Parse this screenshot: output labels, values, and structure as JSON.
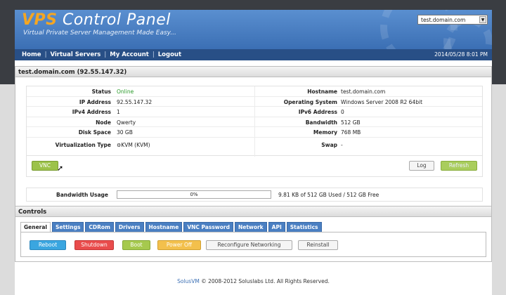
{
  "header": {
    "brand_accent": "VPS",
    "brand_rest": "Control Panel",
    "tagline": "Virtual Private Server Management Made Easy...",
    "server_select_value": "test.domain.com"
  },
  "nav": {
    "items": [
      "Home",
      "Virtual Servers",
      "My Account",
      "Logout"
    ],
    "separator": "|",
    "datetime": "2014/05/28 8:01 PM"
  },
  "server_panel": {
    "title": "test.domain.com (92.55.147.32)",
    "left": [
      {
        "label": "Status",
        "value": "Online"
      },
      {
        "label": "IP Address",
        "value": "92.55.147.32"
      },
      {
        "label": "IPv4 Address",
        "value": "1"
      },
      {
        "label": "Node",
        "value": "Qwerty"
      },
      {
        "label": "Disk Space",
        "value": "30 GB"
      },
      {
        "label": "Virtualization Type",
        "value": "KVM  (KVM)"
      }
    ],
    "right": [
      {
        "label": "Hostname",
        "value": "test.domain.com"
      },
      {
        "label": "Operating System",
        "value": "Windows Server 2008 R2 64bit"
      },
      {
        "label": "IPv6 Address",
        "value": "0"
      },
      {
        "label": "Bandwidth",
        "value": "512 GB"
      },
      {
        "label": "Memory",
        "value": "768 MB"
      },
      {
        "label": "Swap",
        "value": "-"
      }
    ],
    "buttons": {
      "vnc": "VNC",
      "log": "Log",
      "refresh": "Refresh"
    },
    "bandwidth": {
      "label": "Bandwidth Usage",
      "percent_text": "0%",
      "percent": 0,
      "usage_text": "9.81 KB of 512 GB Used / 512 GB Free"
    }
  },
  "controls": {
    "title": "Controls",
    "tabs": [
      "General",
      "Settings",
      "CDRom",
      "Drivers",
      "Hostname",
      "VNC Password",
      "Network",
      "API",
      "Statistics"
    ],
    "active_tab": 0,
    "actions": {
      "reboot": "Reboot",
      "shutdown": "Shutdown",
      "boot": "Boot",
      "poweroff": "Power Off",
      "reconfigure": "Reconfigure Networking",
      "reinstall": "Reinstall"
    }
  },
  "footer": {
    "link": "SolusVM",
    "text": " © 2008-2012 Soluslabs Ltd. All Rights Reserved."
  },
  "colors": {
    "header_blue": "#3b6fb4",
    "nav_blue": "#284f86",
    "accent_orange": "#f4a623",
    "online_green": "#2a9a2a"
  }
}
